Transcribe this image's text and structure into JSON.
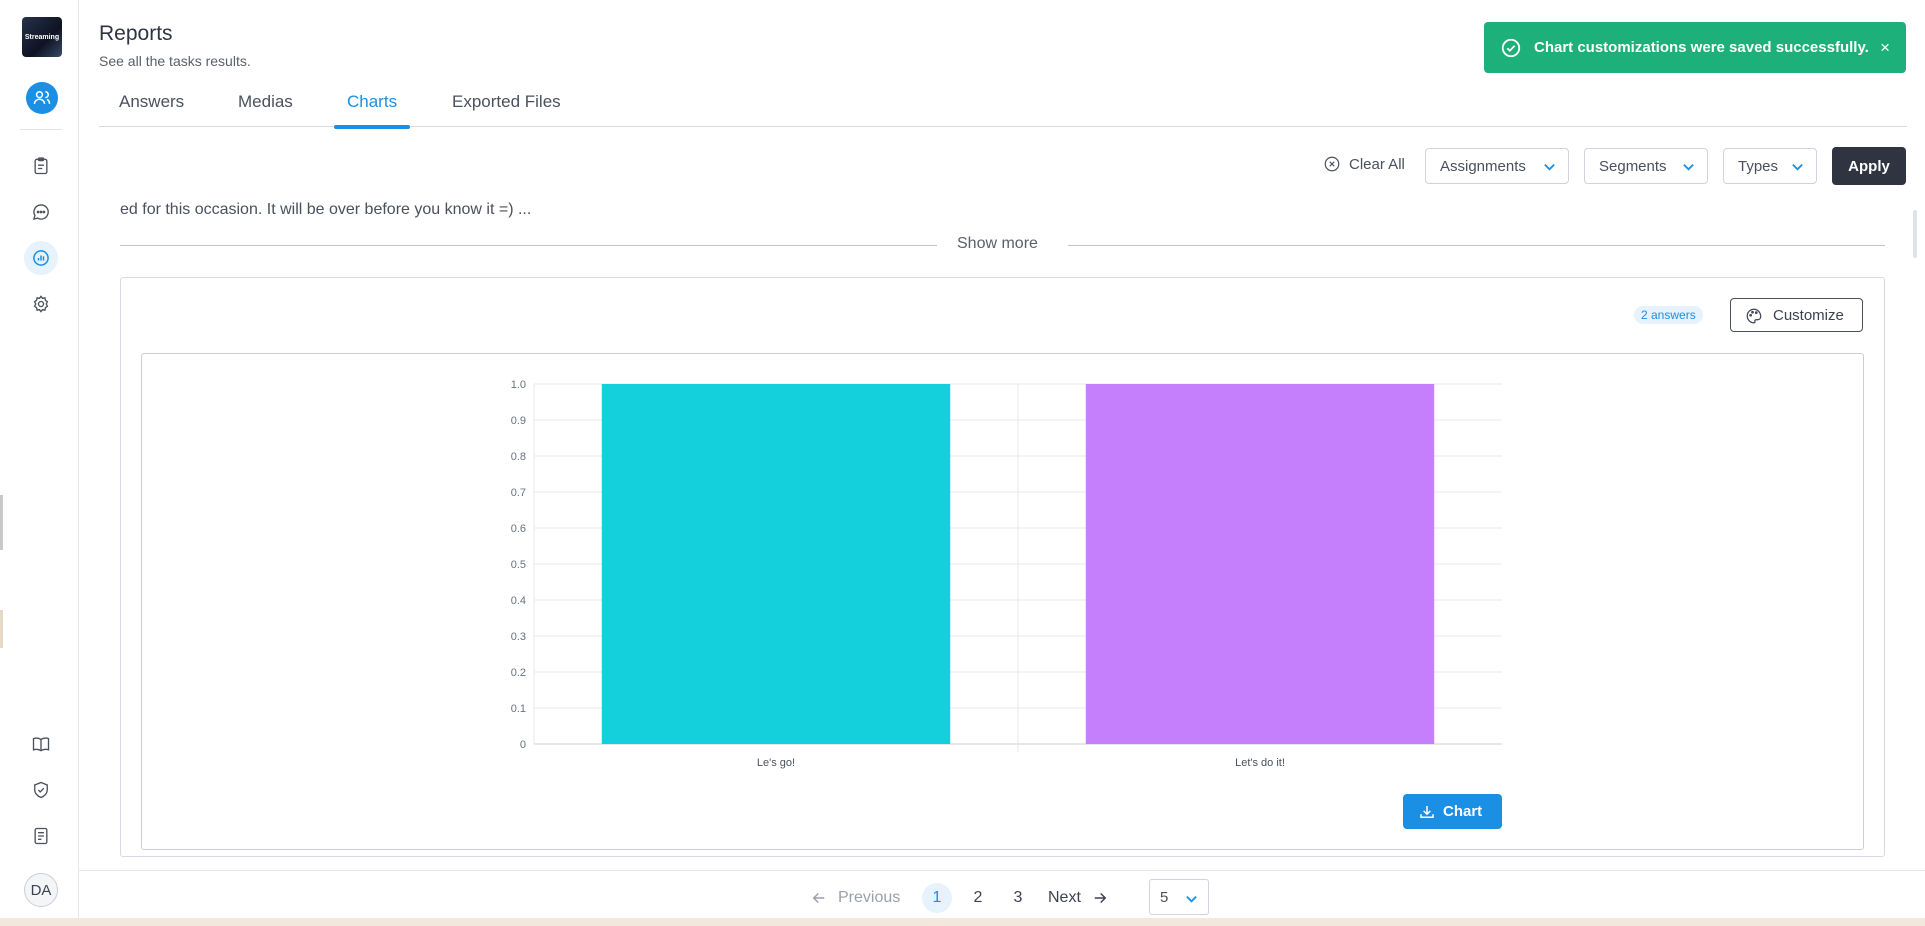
{
  "sidebar": {
    "logo_text": "Streaming",
    "avatar_initials": "DA",
    "icons": [
      "user-icon",
      "clipboard-icon",
      "chat-icon",
      "chart-icon",
      "gear-icon",
      "book-icon",
      "shield-icon",
      "document-icon"
    ]
  },
  "header": {
    "title": "Reports",
    "subtitle": "See all the tasks results."
  },
  "tabs": [
    {
      "label": "Answers"
    },
    {
      "label": "Medias"
    },
    {
      "label": "Charts"
    },
    {
      "label": "Exported Files"
    }
  ],
  "active_tab": "Charts",
  "toast": {
    "message": "Chart customizations were saved successfully.",
    "close": "×"
  },
  "filters": {
    "clear_all": "Clear All",
    "assignments": "Assignments",
    "segments": "Segments",
    "types": "Types",
    "apply": "Apply"
  },
  "question": {
    "truncated_text": "ed for this occasion. It will be over before you know it =)  ...",
    "show_more": "Show more"
  },
  "card": {
    "answers_badge": "2 answers",
    "customize_label": "Customize",
    "download_label": "Chart"
  },
  "chart_data": {
    "type": "bar",
    "categories": [
      "Le's go!",
      "Let's do it!"
    ],
    "values": [
      1.0,
      1.0
    ],
    "colors": [
      "#14d0dd",
      "#c57ffc"
    ],
    "ylim": [
      0,
      1.0
    ],
    "yticks": [
      "0",
      "0.1",
      "0.2",
      "0.3",
      "0.4",
      "0.5",
      "0.6",
      "0.7",
      "0.8",
      "0.9",
      "1.0"
    ],
    "grid": true,
    "title": "",
    "xlabel": "",
    "ylabel": ""
  },
  "pagination": {
    "previous": "Previous",
    "pages": [
      "1",
      "2",
      "3"
    ],
    "current": "1",
    "next": "Next",
    "page_size": "5"
  },
  "colors": {
    "accent": "#1a8fe3",
    "toast_green": "#1db07a",
    "dark_button": "#2f3440"
  }
}
